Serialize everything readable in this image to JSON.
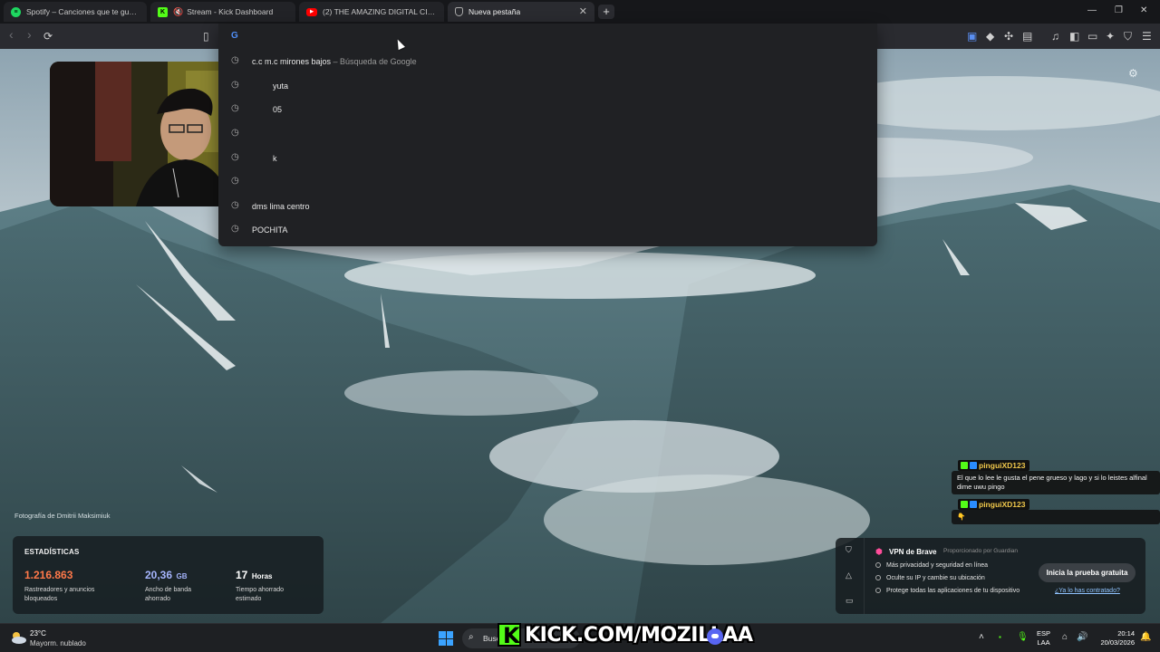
{
  "tabs": [
    {
      "label": "Spotify – Canciones que te gustan",
      "icon": "spotify-icon",
      "color": "#1ed760"
    },
    {
      "label": "Stream - Kick Dashboard",
      "icon": "kick-icon",
      "color": "#53fc18"
    },
    {
      "label": "(2) THE AMAZING DIGITAL CIRCUS -",
      "icon": "youtube-icon",
      "color": "#ff0000"
    },
    {
      "label": "Nueva pestaña",
      "icon": "brave-shield-icon",
      "color": "#9a9a9a"
    }
  ],
  "suggestions": [
    {
      "text": "c.c m.c mirones bajos",
      "sub": " – Búsqueda de Google"
    },
    {
      "text": "yuta",
      "sub": ""
    },
    {
      "text": "05",
      "sub": ""
    },
    {
      "text": "",
      "sub": ""
    },
    {
      "text": "k",
      "sub": ""
    },
    {
      "text": "",
      "sub": ""
    },
    {
      "text": "dms lima centro",
      "sub": ""
    },
    {
      "text": "POCHITA",
      "sub": ""
    }
  ],
  "background": {
    "credit": "Fotografía de Dmitrii Maksimiuk"
  },
  "stats": {
    "title": "ESTADÍSTICAS",
    "items": [
      {
        "value": "1.216.863",
        "unit": "",
        "desc": "Rastreadores y anuncios bloqueados",
        "color": "#ff7849"
      },
      {
        "value": "20,36",
        "unit": "GB",
        "desc": "Ancho de banda ahorrado",
        "color": "#a5b4fc"
      },
      {
        "value": "17",
        "unit": "Horas",
        "desc": "Tiempo ahorrado estimado",
        "color": "#ffffff"
      }
    ]
  },
  "vpn": {
    "title": "VPN de Brave",
    "powered_by": "Proporcionado por  Guardian",
    "features": [
      "Más privacidad y seguridad en línea",
      "Oculte su IP y cambie su ubicación",
      "Protege todas las aplicaciones de tu dispositivo"
    ],
    "cta": "Inicia la prueba gratuita",
    "already": "¿Ya lo has contratado?"
  },
  "chat": [
    {
      "user": "pinguiXD123",
      "message": "El que lo lee le gusta el pene grueso y lago y si lo leistes alfinal dime uwu pingo"
    },
    {
      "user": "pinguiXD123",
      "message": "👇"
    }
  ],
  "taskbar": {
    "temp": "23°C",
    "weather": "Mayorm. nublado",
    "search_placeholder": "Busc",
    "kick_text": "KICK.COM/MOZILLAA",
    "lang_1": "ESP",
    "lang_2": "LAA",
    "time": "20:14",
    "date": "20/03/2026"
  },
  "colors": {
    "accent_kick": "#53fc18",
    "toolbar": "#2a2b30",
    "tabstrip": "#16171a"
  }
}
